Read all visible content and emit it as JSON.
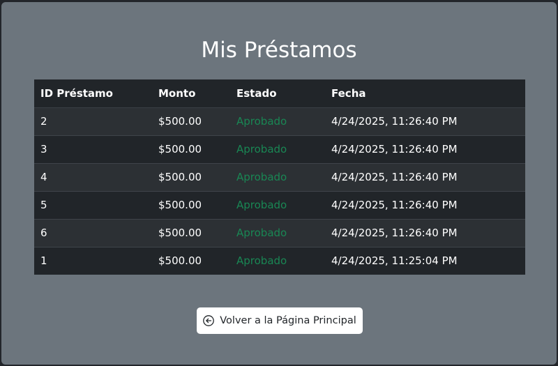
{
  "page": {
    "title": "Mis Préstamos"
  },
  "table": {
    "headers": {
      "id": "ID Préstamo",
      "amount": "Monto",
      "status": "Estado",
      "date": "Fecha"
    },
    "rows": [
      {
        "id": "2",
        "amount": "$500.00",
        "status": "Aprobado",
        "date": "4/24/2025, 11:26:40 PM"
      },
      {
        "id": "3",
        "amount": "$500.00",
        "status": "Aprobado",
        "date": "4/24/2025, 11:26:40 PM"
      },
      {
        "id": "4",
        "amount": "$500.00",
        "status": "Aprobado",
        "date": "4/24/2025, 11:26:40 PM"
      },
      {
        "id": "5",
        "amount": "$500.00",
        "status": "Aprobado",
        "date": "4/24/2025, 11:26:40 PM"
      },
      {
        "id": "6",
        "amount": "$500.00",
        "status": "Aprobado",
        "date": "4/24/2025, 11:26:40 PM"
      },
      {
        "id": "1",
        "amount": "$500.00",
        "status": "Aprobado",
        "date": "4/24/2025, 11:25:04 PM"
      }
    ]
  },
  "back_button": {
    "label": "Volver a la Página Principal",
    "icon": "arrow-left-circle-icon"
  },
  "colors": {
    "background": "#6c757d",
    "table_dark": "#212529",
    "table_striped": "#2c3034",
    "status_approved": "#198754",
    "button_bg": "#ffffff"
  }
}
